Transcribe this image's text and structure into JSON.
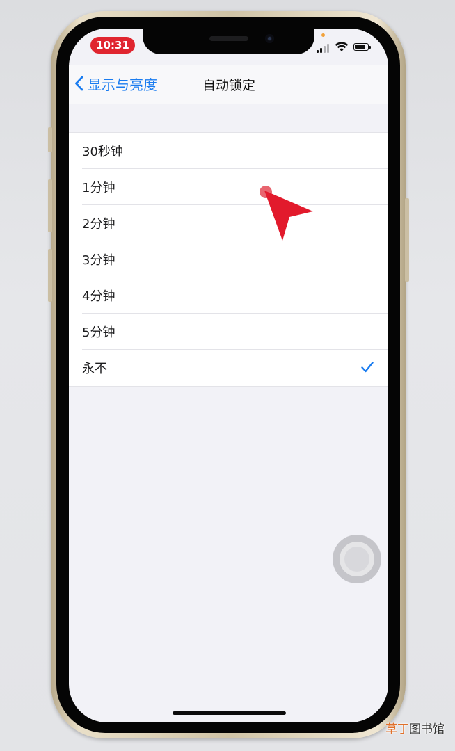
{
  "status_bar": {
    "time": "10:31"
  },
  "nav": {
    "back_label": "显示与亮度",
    "title": "自动锁定"
  },
  "options": [
    {
      "label": "30秒钟",
      "selected": false
    },
    {
      "label": "1分钟",
      "selected": false
    },
    {
      "label": "2分钟",
      "selected": false
    },
    {
      "label": "3分钟",
      "selected": false
    },
    {
      "label": "4分钟",
      "selected": false
    },
    {
      "label": "5分钟",
      "selected": false
    },
    {
      "label": "永不",
      "selected": true
    }
  ],
  "watermark": {
    "accent": "草丁",
    "rest": "图书馆"
  },
  "colors": {
    "accent": "#1a7cf0",
    "time_pill": "#e0252f",
    "pointer": "#e21a2c"
  }
}
